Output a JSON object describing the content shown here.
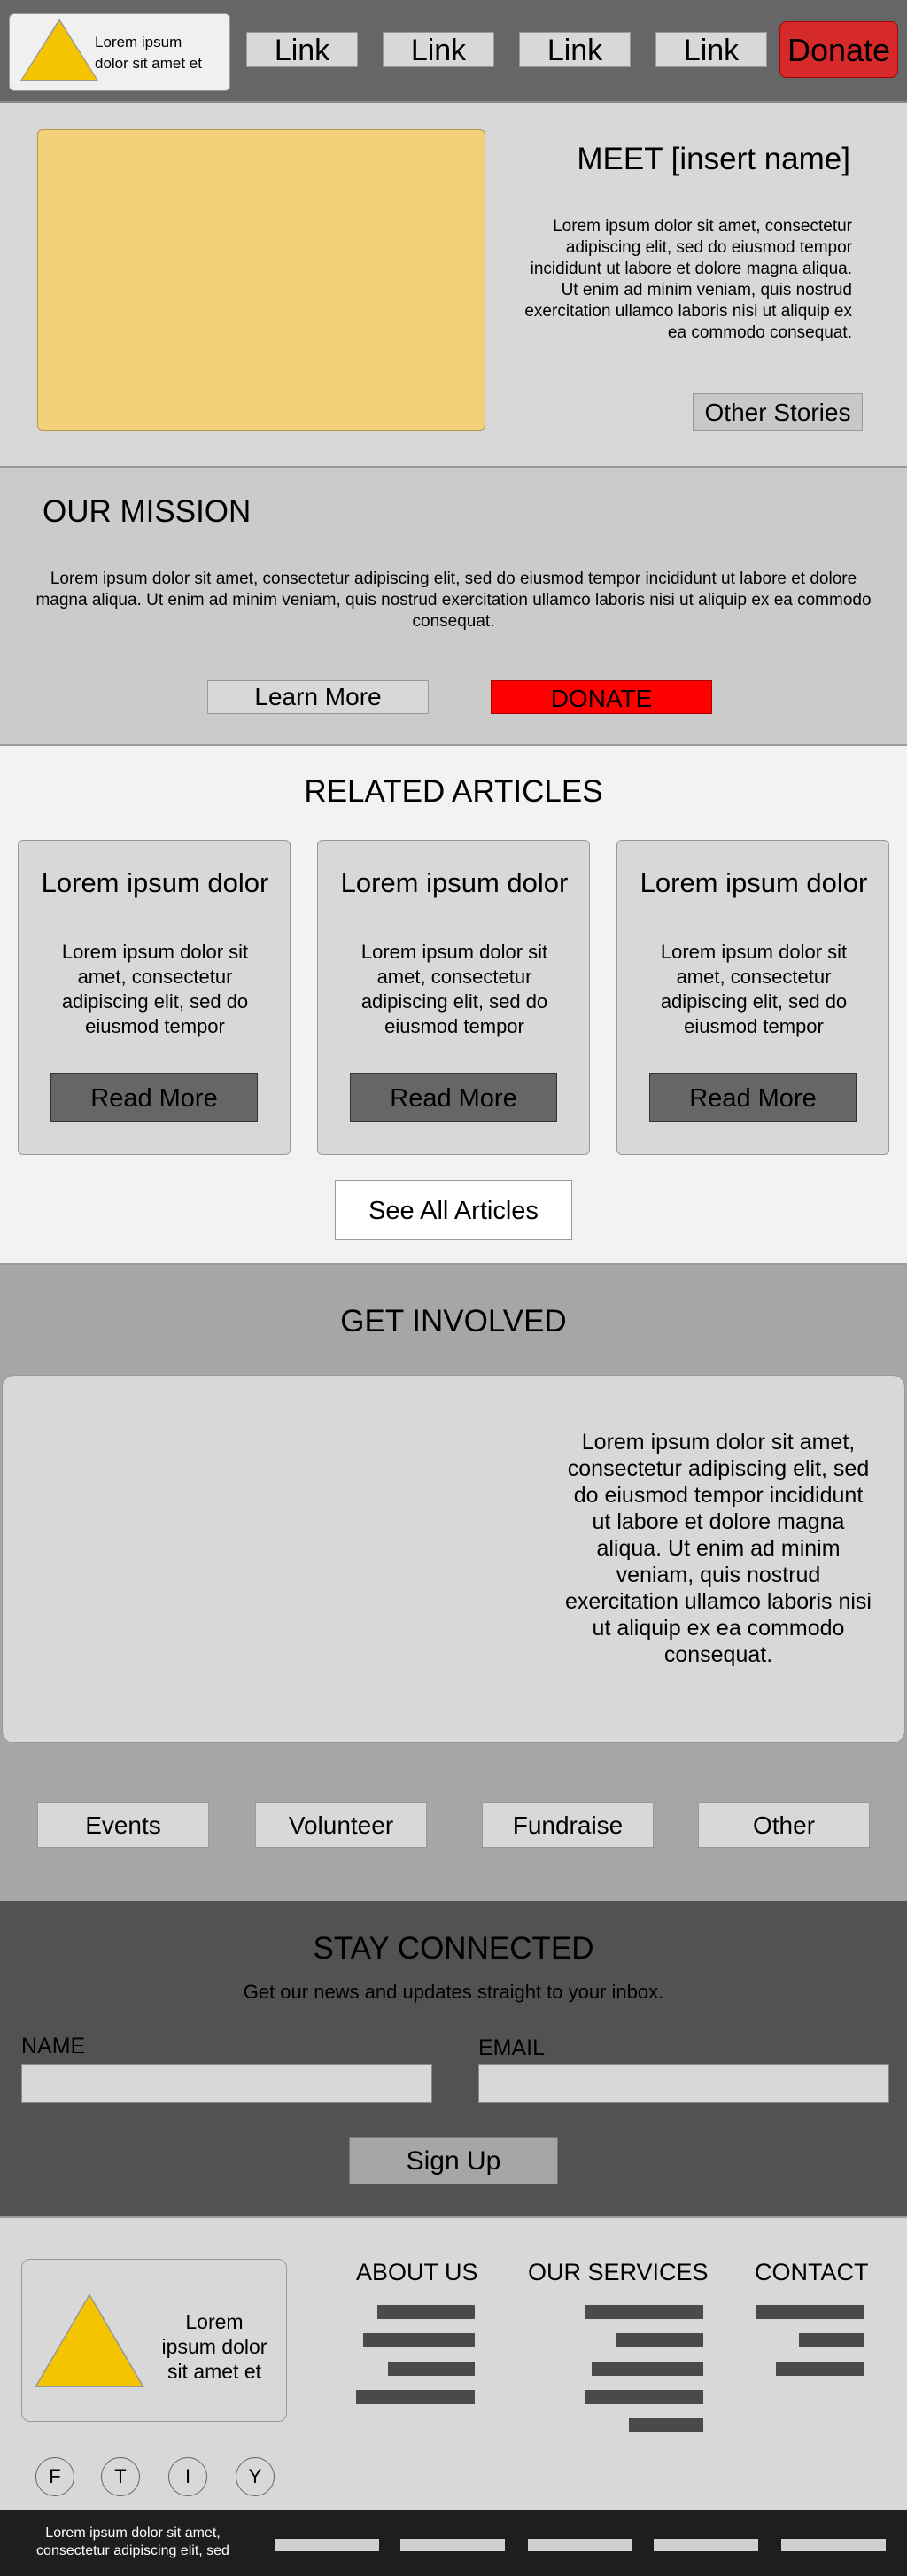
{
  "header": {
    "logo_text": "Lorem ipsum dolor sit amet et",
    "nav_links": [
      "Link",
      "Link",
      "Link",
      "Link"
    ],
    "donate_label": "Donate"
  },
  "hero": {
    "title": "MEET [insert name]",
    "body": "Lorem ipsum dolor sit amet, consectetur adipiscing elit, sed do eiusmod tempor incididunt ut labore et dolore magna aliqua. Ut enim ad minim veniam, quis nostrud exercitation ullamco laboris nisi ut aliquip ex ea commodo consequat.",
    "other_stories_label": "Other Stories"
  },
  "mission": {
    "title": "OUR MISSION",
    "body": "Lorem ipsum dolor sit amet, consectetur adipiscing elit, sed do eiusmod tempor incididunt ut labore et dolore magna aliqua. Ut enim ad minim veniam, quis nostrud exercitation ullamco laboris nisi ut aliquip ex ea commodo consequat.",
    "learn_more_label": "Learn More",
    "donate_label": "DONATE"
  },
  "related": {
    "title": "RELATED ARTICLES",
    "cards": [
      {
        "title": "Lorem ipsum dolor",
        "body": "Lorem ipsum dolor sit amet, consectetur adipiscing elit, sed do eiusmod tempor",
        "button": "Read More"
      },
      {
        "title": "Lorem ipsum dolor",
        "body": "Lorem ipsum dolor sit amet, consectetur adipiscing elit, sed do eiusmod tempor",
        "button": "Read More"
      },
      {
        "title": "Lorem ipsum dolor",
        "body": "Lorem ipsum dolor sit amet, consectetur adipiscing elit, sed do eiusmod tempor",
        "button": "Read More"
      }
    ],
    "see_all_label": "See All Articles"
  },
  "involved": {
    "title": "GET INVOLVED",
    "body": "Lorem ipsum dolor sit amet, consectetur adipiscing elit, sed do eiusmod tempor incididunt ut labore et dolore magna aliqua. Ut enim ad minim veniam, quis nostrud exercitation ullamco laboris nisi ut aliquip ex ea commodo consequat.",
    "buttons": [
      "Events",
      "Volunteer",
      "Fundraise",
      "Other"
    ]
  },
  "connected": {
    "title": "STAY CONNECTED",
    "subtitle": "Get our news and updates straight to your inbox.",
    "name_label": "NAME",
    "email_label": "EMAIL",
    "signup_label": "Sign Up"
  },
  "footer": {
    "logo_text": "Lorem ipsum dolor sit amet et",
    "social": [
      "F",
      "T",
      "I",
      "Y"
    ],
    "columns": [
      "ABOUT US",
      "OUR SERVICES",
      "CONTACT"
    ],
    "copyright": "Lorem ipsum dolor sit amet, consectetur adipiscing elit, sed"
  },
  "colors": {
    "accent_donate": "#d62a2a",
    "mission_donate": "#ff0000",
    "logo_yellow": "#f5c400",
    "hero_image": "#f3d07a"
  }
}
